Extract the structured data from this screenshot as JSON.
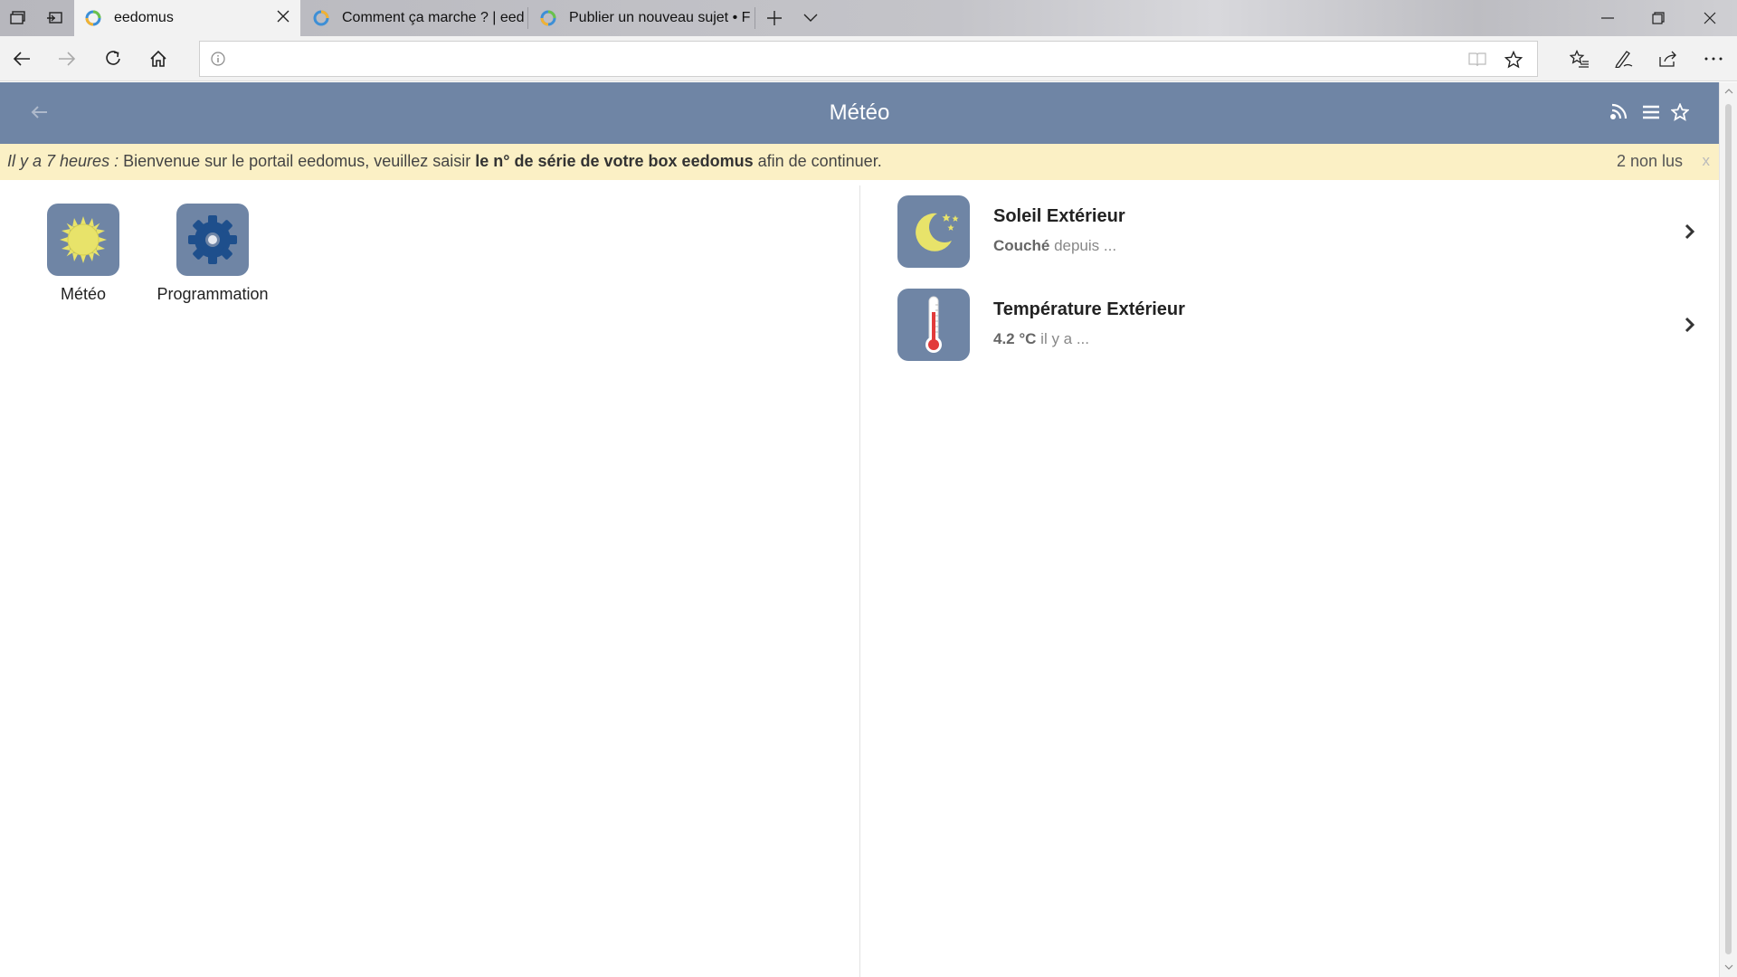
{
  "browser": {
    "tabs": [
      {
        "title": "eedomus",
        "active": true
      },
      {
        "title": "Comment ça marche ? | eed",
        "active": false
      },
      {
        "title": "Publier un nouveau sujet • F",
        "active": false
      }
    ],
    "address": {
      "value": "",
      "placeholder": ""
    }
  },
  "app": {
    "title": "Météo",
    "notice": {
      "time": "Il y a 7 heures :",
      "text_before": " Bienvenue sur le portail eedomus, veuillez saisir ",
      "bold": "le n° de série de votre box eedomus",
      "text_after": " afin de continuer.",
      "unread": "2 non lus",
      "close": "x"
    },
    "tiles": [
      {
        "label": "Météo",
        "icon": "sun-icon"
      },
      {
        "label": "Programmation",
        "icon": "gear-icon"
      }
    ],
    "devices": [
      {
        "name": "Soleil Extérieur",
        "value": "Couché",
        "rest": " depuis ...",
        "icon": "moon-icon"
      },
      {
        "name": "Température Extérieur",
        "value": "4.2 °C",
        "rest": " il y a ...",
        "icon": "thermometer-icon"
      }
    ]
  },
  "colors": {
    "header": "#6f85a5",
    "notice": "#fbf0c5",
    "sun": "#e8e36a",
    "gear": "#1e4f8c"
  }
}
